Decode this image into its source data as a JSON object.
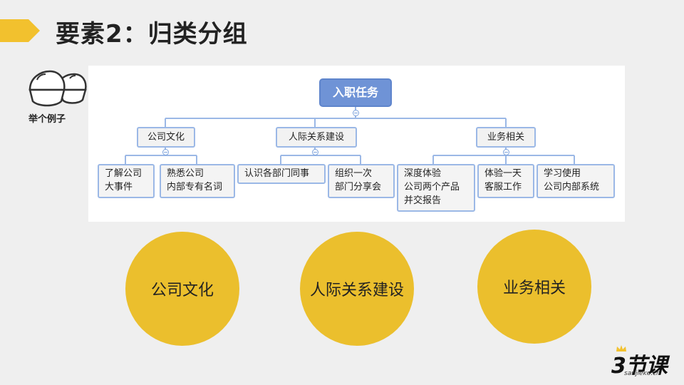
{
  "header": {
    "title": "要素2：归类分组"
  },
  "example": {
    "label": "举个例子",
    "icon": "chestnut-icon"
  },
  "diagram": {
    "root": "入职任务",
    "branches": [
      {
        "label": "公司文化",
        "children": [
          [
            "了解公司",
            "大事件"
          ],
          [
            "熟悉公司",
            "内部专有名词"
          ]
        ]
      },
      {
        "label": "人际关系建设",
        "children": [
          [
            "认识各部门同事"
          ],
          [
            "组织一次",
            "部门分享会"
          ]
        ]
      },
      {
        "label": "业务相关",
        "children": [
          [
            "深度体验",
            "公司两个产品",
            "并交报告"
          ],
          [
            "体验一天",
            "客服工作"
          ],
          [
            "学习使用",
            "公司内部系统"
          ]
        ]
      }
    ]
  },
  "circles": [
    "公司文化",
    "人际关系建设",
    "业务相关"
  ],
  "logo": {
    "main": "3节课",
    "sub": "sanjieke.cn"
  },
  "colors": {
    "accent": "#f2c12e",
    "circle": "#ebbf2d",
    "root": "#6f93d6",
    "border": "#9bb8e6"
  }
}
